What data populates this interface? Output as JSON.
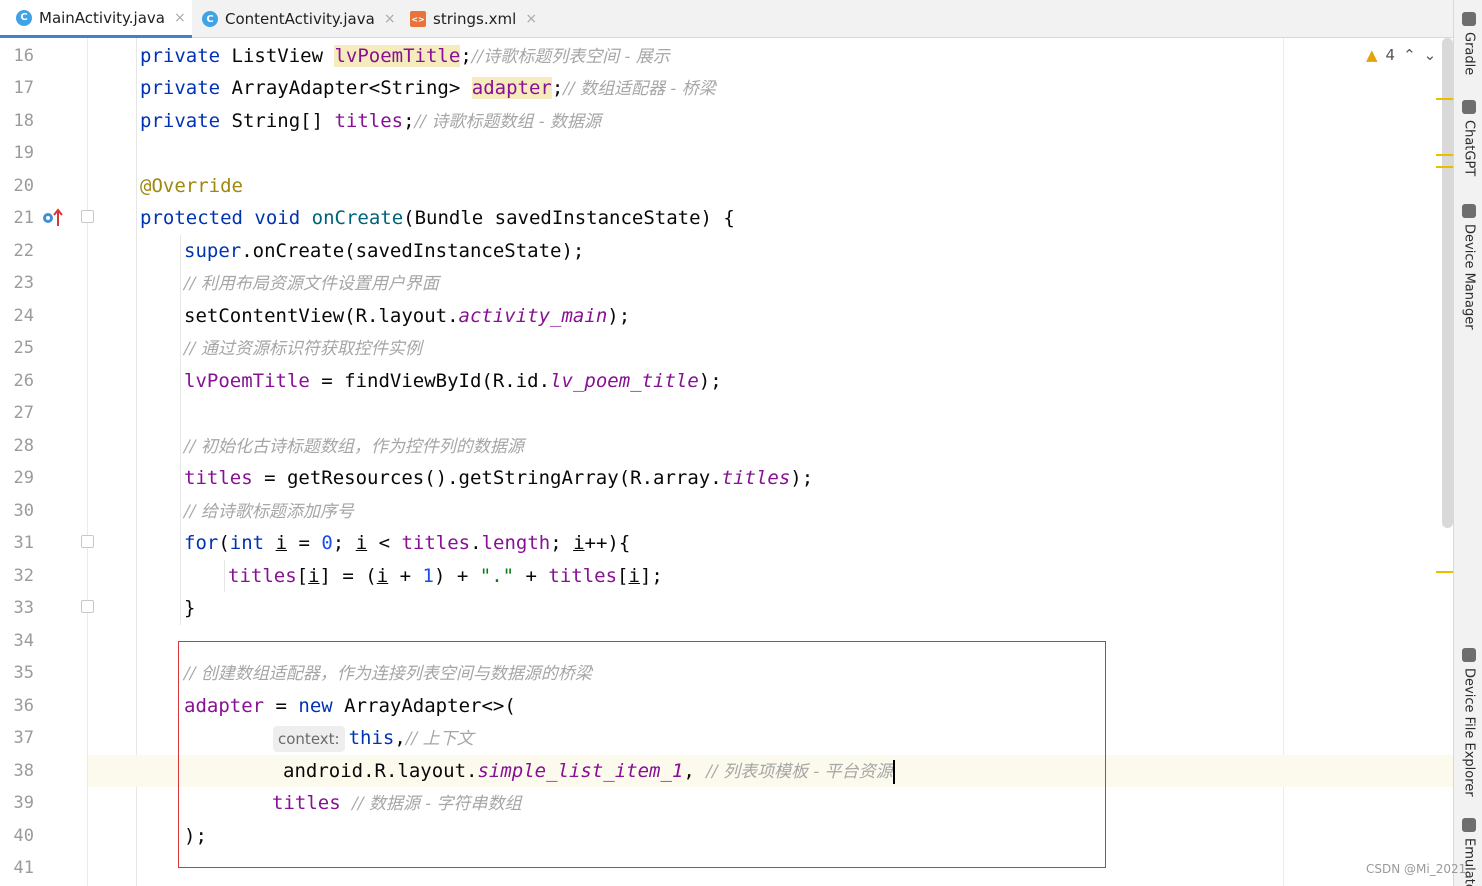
{
  "tabs": [
    {
      "icon": "C",
      "label": "MainActivity.java",
      "active": true
    },
    {
      "icon": "C",
      "label": "ContentActivity.java",
      "active": false
    },
    {
      "icon": "<>",
      "label": "strings.xml",
      "active": false
    }
  ],
  "tab_close_glyph": "×",
  "inspection": {
    "warning_count": "4"
  },
  "right_tools": [
    "Gradle",
    "ChatGPT",
    "Device Manager",
    "Device File Explorer",
    "Emulator"
  ],
  "watermark": "CSDN @Mi_2021",
  "line_numbers": [
    "16",
    "17",
    "18",
    "19",
    "20",
    "21",
    "22",
    "23",
    "24",
    "25",
    "26",
    "27",
    "28",
    "29",
    "30",
    "31",
    "32",
    "33",
    "34",
    "35",
    "36",
    "37",
    "38",
    "39",
    "40",
    "41"
  ],
  "code": {
    "l16": {
      "kw": "private",
      "type": " ListView ",
      "field": "lvPoemTitle",
      "semi": ";",
      "comment": "//诗歌标题列表空间 - 展示"
    },
    "l17": {
      "kw": "private",
      "type": " ArrayAdapter<String> ",
      "field": "adapter",
      "semi": ";",
      "comment": "// 数组适配器 - 桥梁"
    },
    "l18": {
      "kw": "private",
      "type": " String[] ",
      "field": "titles",
      "semi": ";",
      "comment": "// 诗歌标题数组 - 数据源"
    },
    "l20": {
      "anno": "@Override"
    },
    "l21": {
      "kw1": "protected",
      "kw2": "void",
      "method": "onCreate",
      "rest": "(Bundle savedInstanceState) {"
    },
    "l22": {
      "kw": "super",
      "rest": ".onCreate(savedInstanceState);"
    },
    "l23": {
      "comment": "// 利用布局资源文件设置用户界面"
    },
    "l24": {
      "pre": "setContentView(R.layout.",
      "it": "activity_main",
      "post": ");"
    },
    "l25": {
      "comment": "// 通过资源标识符获取控件实例"
    },
    "l26": {
      "field": "lvPoemTitle",
      "pre": " = findViewById(R.id.",
      "it": "lv_poem_title",
      "post": ");"
    },
    "l28": {
      "comment": "// 初始化古诗标题数组，作为控件列的数据源"
    },
    "l29": {
      "field": "titles",
      "pre": " = getResources().getStringArray(R.array.",
      "it": "titles",
      "post": ");"
    },
    "l30": {
      "comment": "// 给诗歌标题添加序号"
    },
    "l31": {
      "kw1": "for",
      "p1": "(",
      "kw2": "int",
      "v1": "i",
      "p2": " = ",
      "n0": "0",
      "p3": "; ",
      "v2": "i",
      "p4": " < ",
      "field": "titles",
      "p5": ".",
      "field2": "length",
      "p6": "; ",
      "v3": "i",
      "p7": "++){"
    },
    "l32": {
      "field": "titles",
      "p1": "[",
      "v1": "i",
      "p2": "] = (",
      "v2": "i",
      "p3": " + ",
      "n1": "1",
      "p4": ") + ",
      "str": "\".\"",
      "p5": " + ",
      "field2": "titles",
      "p6": "[",
      "v3": "i",
      "p7": "];"
    },
    "l33": {
      "text": "}"
    },
    "l35": {
      "comment": "// 创建数组适配器，作为连接列表空间与数据源的桥梁"
    },
    "l36": {
      "field": "adapter",
      "p1": " = ",
      "kw": "new",
      "rest": " ArrayAdapter<>("
    },
    "l37": {
      "hint": "context:",
      "kw": "this",
      "p1": ",",
      "comment": "// 上下文"
    },
    "l38": {
      "pre": "android.R.layout.",
      "it": "simple_list_item_1",
      "p1": ", ",
      "comment": "// 列表项模板 - 平台资源"
    },
    "l39": {
      "field": "titles",
      "p1": " ",
      "comment": "// 数据源 - 字符串数组"
    },
    "l40": {
      "text": ");"
    }
  }
}
